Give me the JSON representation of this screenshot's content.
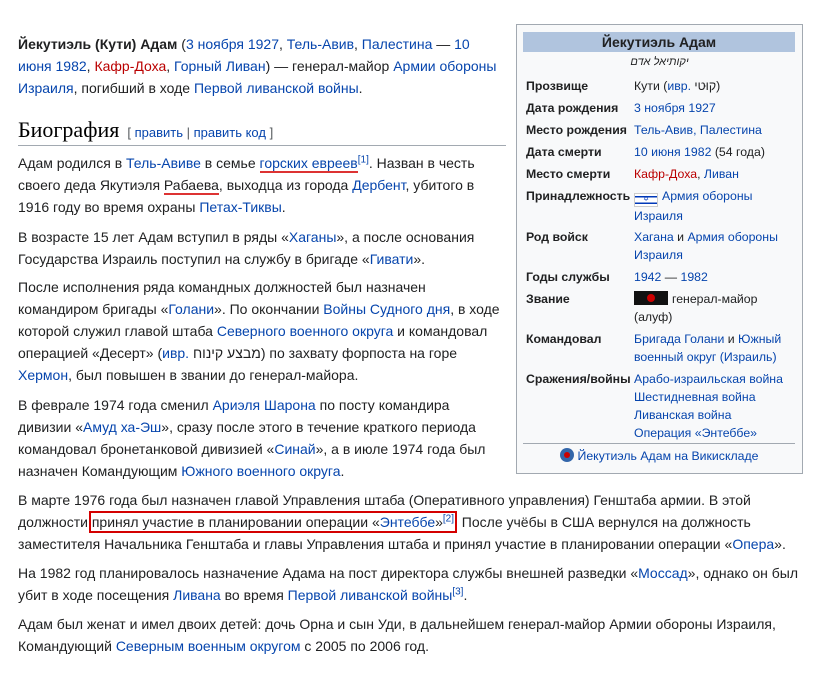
{
  "intro": {
    "name": "Йекутиэль (Кути) Адам",
    "open": "(",
    "birth_date": "3 ноября 1927",
    "c1": ", ",
    "birth_city": "Тель-Авив",
    "c2": ", ",
    "birth_country": "Палестина",
    "dash": " — ",
    "death_date": "10 июня 1982",
    "c3": ", ",
    "death_place": "Кафр-Доха",
    "c4": ", ",
    "death_region": "Горный Ливан",
    "close": ") — генерал-майор ",
    "army": "Армии обороны Израиля",
    "t1": ", погибший в ходе ",
    "war": "Первой ливанской войны",
    "t2": "."
  },
  "section": {
    "title": "Биография",
    "edit_open": "[ ",
    "edit": "править",
    "sep": " | ",
    "edit_code": "править код",
    "edit_close": " ]"
  },
  "p1": {
    "t1": "Адам родился в ",
    "l1": "Тель-Авиве",
    "t2": " в семье ",
    "l2": "горских евреев",
    "ref": "[1]",
    "t3": ". Назван в честь своего деда Якутиэля ",
    "u1": "Рабаева",
    "t4": ", выходца из города ",
    "l3": "Дербент",
    "t5": ", убитого в 1916 году во время охраны ",
    "l4": "Петах-Тиквы",
    "t6": "."
  },
  "p2": {
    "t1": "В возрасте 15 лет Адам вступил в ряды «",
    "l1": "Хаганы",
    "t2": "», а после основания Государства Израиль поступил на службу в бригаде «",
    "l2": "Гивати",
    "t3": "»."
  },
  "p3": {
    "t1": "После исполнения ряда командных должностей был назначен командиром бригады «",
    "l1": "Голани",
    "t2": "». По окончании ",
    "l2": "Войны Судного дня",
    "t3": ", в ходе которой служил главой штаба ",
    "l3": "Северного военного округа",
    "t4": " и командовал операцией «Десерт» (",
    "l4": "ивр.",
    "t5": " מבצע קינוח‏",
    "t6": ") по захвату форпоста на горе ",
    "l5": "Хермон",
    "t7": ", был повышен в звании до генерал-майора."
  },
  "p4": {
    "t1": "В феврале 1974 года сменил ",
    "l1": "Ариэля Шарона",
    "t2": " по посту командира дивизии «",
    "l2": "Амуд ха-Эш",
    "t3": "», сразу после этого в течение краткого периода командовал бронетанковой дивизией «",
    "l3": "Синай",
    "t4": "», а в июле 1974 года был назначен Командующим ",
    "l4": "Южного военного округа",
    "t5": "."
  },
  "p5": {
    "t1": "В марте 1976 года был назначен главой Управления штаба (Оперативного управления) Генштаба армии. В этой должности ",
    "h1": "принял участие в планировании операции «",
    "hl": "Энтеббе",
    "h2": "»",
    "ref": "[2]",
    "t2": ". После учёбы в США вернулся на должность заместителя Начальника Генштаба и главы Управления штаба и принял участие в планировании операции «",
    "l1": "Опера",
    "t3": "»."
  },
  "p6": {
    "t1": "На 1982 год планировалось назначение Адама на пост директора службы внешней разведки «",
    "l1": "Моссад",
    "t2": "», однако он был убит в ходе посещения ",
    "l2": "Ливана",
    "t3": " во время ",
    "l3": "Первой ливанской войны",
    "ref": "[3]",
    "t4": "."
  },
  "p7": {
    "t1": "Адам был женат и имел двоих детей: дочь Орна и сын Уди, в дальнейшем генерал-майор Армии обороны Израиля, Командующий ",
    "l1": "Северным военным округом",
    "t2": " с 2005 по 2006 год."
  },
  "infobox": {
    "title": "Йекутиэль Адам",
    "native": "יקותיאל אדם",
    "nickname_k": "Прозвище",
    "nickname_v1": "Кути (",
    "nickname_l": "ивр.",
    "nickname_v2": " קוּטי)",
    "birth_k": "Дата рождения",
    "birth_v": "3 ноября 1927",
    "birthplace_k": "Место рождения",
    "birthplace_v": "Тель-Авив, Палестина",
    "death_k": "Дата смерти",
    "death_v": "10 июня 1982",
    "death_age": " (54 года)",
    "deathplace_k": "Место смерти",
    "deathplace_v1": "Кафр-Доха",
    "deathplace_sep": ", ",
    "deathplace_v2": "Ливан",
    "affil_k": "Принадлежность",
    "affil_v": "Армия обороны Израиля",
    "branch_k": "Род войск",
    "branch_l1": "Хагана",
    "branch_and": " и ",
    "branch_l2": "Армия обороны Израиля",
    "years_k": "Годы службы",
    "years_from": "1942",
    "years_dash": " — ",
    "years_to": "1982",
    "rank_k": "Звание",
    "rank_v": "генерал-майор (алуф)",
    "cmd_k": "Командовал",
    "cmd_l1": "Бригада Голани",
    "cmd_and": " и ",
    "cmd_l2": "Южный военный округ (Израиль)",
    "battles_k": "Сражения/войны",
    "battles": [
      "Арабо-израильская война",
      "Шестидневная война",
      "Ливанская война",
      "Операция «Энтеббе»"
    ],
    "commons": "Йекутиэль Адам на Викискладе"
  }
}
